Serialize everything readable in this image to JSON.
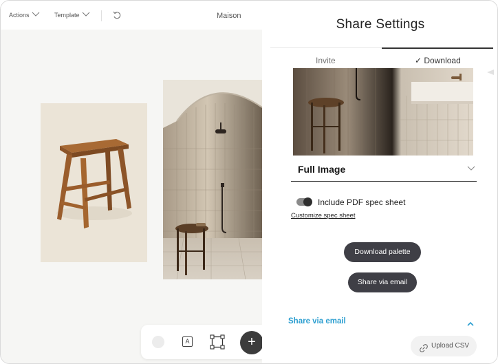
{
  "topbar": {
    "actions_label": "Actions",
    "template_label": "Template",
    "doc_title": "Maison"
  },
  "canvas": {
    "images": [
      "wooden-stool-photo",
      "shower-room-photo"
    ],
    "toolbar": {
      "text_tool_glyph": "A",
      "add_glyph": "+"
    }
  },
  "panel": {
    "title": "Share Settings",
    "tabs": [
      {
        "label": "Invite",
        "active": false
      },
      {
        "label": "✓ Download",
        "active": true
      }
    ],
    "image_option": {
      "selected": "Full Image"
    },
    "pdf_toggle": {
      "label": "Include PDF spec sheet",
      "on": true
    },
    "customize_link": "Customize spec sheet",
    "download_palette_button": "Download palette",
    "share_email_button": "Share via email",
    "accordion": {
      "title": "Share via email",
      "expanded": true
    },
    "upload_csv_button": "Upload CSV"
  },
  "colors": {
    "accent_blue": "#2b9ed0",
    "pill_dark": "#3f3f46",
    "toggle_knob": "#2e2e2e"
  }
}
